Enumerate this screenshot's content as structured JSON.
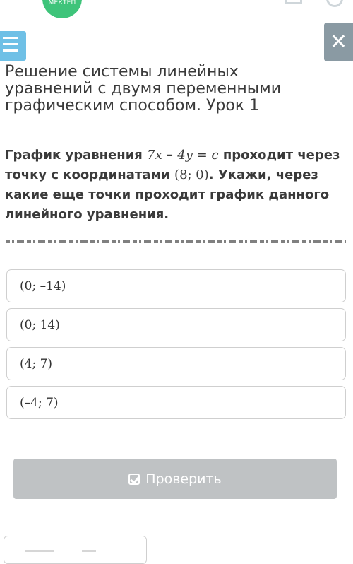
{
  "header": {
    "logo_text": "МЕКТЕП"
  },
  "lesson": {
    "title": "Решение системы линейных уравнений с двумя переменными графическим способом. Урок 1"
  },
  "question": {
    "text_before": "График уравнения ",
    "eq_7x": "7x",
    "eq_minus": " – ",
    "eq_4y": "4y",
    "eq_equals": " = ",
    "eq_c": "c",
    "text_mid": " проходит через точку с координатами ",
    "point": "(8; 0)",
    "text_after": ". Укажи, через какие еще точки проходит график данного линейного уравнения."
  },
  "options": [
    {
      "label": "(0; –14)"
    },
    {
      "label": "(0; 14)"
    },
    {
      "label": "(4; 7)"
    },
    {
      "label": "(–4; 7)"
    }
  ],
  "actions": {
    "check_label": "Проверить"
  },
  "colors": {
    "menu_button": "#6fc0e6",
    "close_button": "#8a9aa3",
    "check_button": "#bfc2c4",
    "logo": "#3ec47a"
  }
}
